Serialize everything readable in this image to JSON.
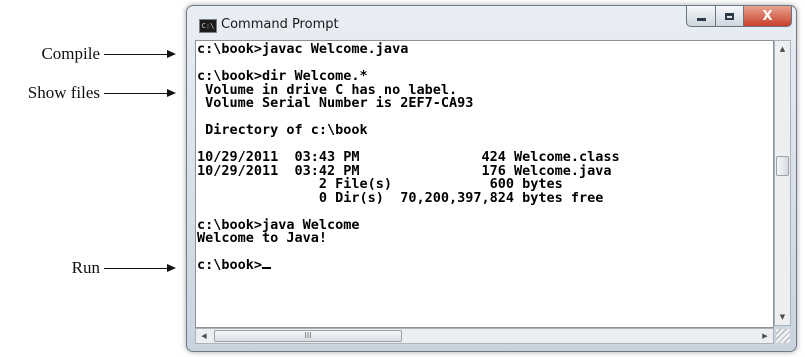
{
  "annotations": {
    "compile": "Compile",
    "show_files": "Show files",
    "run": "Run"
  },
  "window": {
    "title": "Command Prompt",
    "app_icon_text": "C:\\",
    "close_glyph": "X"
  },
  "console": {
    "lines": [
      "c:\\book>javac Welcome.java",
      "",
      "c:\\book>dir Welcome.*",
      " Volume in drive C has no label.",
      " Volume Serial Number is 2EF7-CA93",
      "",
      " Directory of c:\\book",
      "",
      "10/29/2011  03:43 PM               424 Welcome.class",
      "10/29/2011  03:42 PM               176 Welcome.java",
      "               2 File(s)            600 bytes",
      "               0 Dir(s)  70,200,397,824 bytes free",
      "",
      "c:\\book>java Welcome",
      "Welcome to Java!",
      "",
      "c:\\book>"
    ]
  },
  "scrollbar": {
    "up_arrow": "▲",
    "down_arrow": "▼",
    "left_arrow": "◀",
    "right_arrow": "▶",
    "h_thumb_grip": "III"
  },
  "colors": {
    "close_button": "#c7402a",
    "console_background": "#ffffff",
    "console_text": "#000000"
  }
}
